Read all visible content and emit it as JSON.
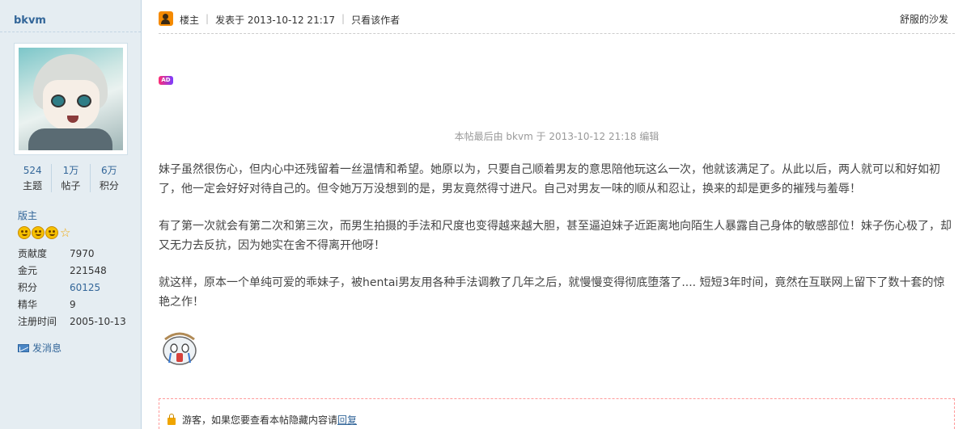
{
  "author": {
    "name": "bkvm",
    "stats": [
      {
        "num": "524",
        "label": "主题"
      },
      {
        "num": "1万",
        "label": "帖子"
      },
      {
        "num": "6万",
        "label": "积分"
      }
    ],
    "rank": "版主",
    "profile": [
      {
        "key": "贡献度",
        "value": "7970"
      },
      {
        "key": "金元",
        "value": "221548"
      },
      {
        "key": "积分",
        "value": "60125"
      },
      {
        "key": "精华",
        "value": "9"
      },
      {
        "key": "注册时间",
        "value": "2005-10-13"
      }
    ],
    "pm_label": "发消息"
  },
  "post_header": {
    "role": "楼主",
    "posted": "发表于 2013-10-12 21:17",
    "author_only": "只看该作者",
    "floor": "舒服的沙发"
  },
  "ad_label": "AD",
  "edit_note": "本帖最后由 bkvm 于 2013-10-12 21:18 编辑",
  "paragraphs": [
    "妹子虽然很伤心，但内心中还残留着一丝温情和希望。她原以为，只要自己顺着男友的意思陪他玩这么一次，他就该满足了。从此以后，两人就可以和好如初了，他一定会好好对待自己的。但令她万万没想到的是，男友竟然得寸进尺。自己对男友一味的顺从和忍让，换来的却是更多的摧残与羞辱！",
    "有了第一次就会有第二次和第三次，而男生拍摄的手法和尺度也变得越来越大胆，甚至逼迫妹子近距离地向陌生人暴露自己身体的敏感部位！妹子伤心极了，却又无力去反抗，因为她实在舍不得离开他呀！",
    "就这样，原本一个单纯可爱的乖妹子，被hentai男友用各种手法调教了几年之后，就慢慢变得彻底堕落了.... 短短3年时间，竟然在互联网上留下了数十套的惊艳之作！"
  ],
  "locked": {
    "text": "游客，如果您要查看本帖隐藏内容请",
    "link": "回复"
  }
}
